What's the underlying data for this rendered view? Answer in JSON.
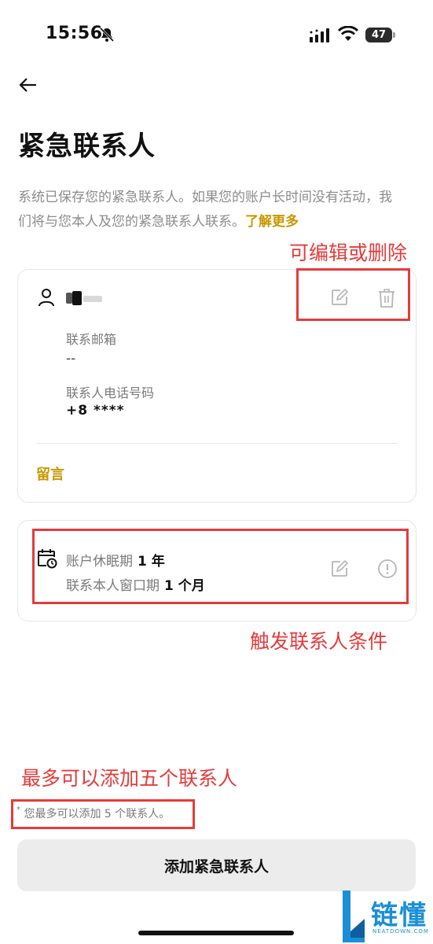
{
  "status_bar": {
    "time": "15:56",
    "battery_level": "47",
    "icons": [
      "bell-muted-icon",
      "signal-icon",
      "wifi-icon",
      "battery-icon"
    ]
  },
  "header": {
    "title": "紧急联系人"
  },
  "description": {
    "text": "系统已保存您的紧急联系人。如果您的账户长时间没有活动，我们将与您本人及您的紧急联系人联系。",
    "link": "了解更多"
  },
  "annotations": {
    "edit_delete": "可编辑或删除",
    "trigger": "触发联系人条件",
    "max": "最多可以添加五个联系人"
  },
  "contact_card": {
    "email_label": "联系邮箱",
    "email_value": "--",
    "phone_label": "联系人电话号码",
    "phone_value": "+8 ****",
    "message_link": "留言"
  },
  "conditions_card": {
    "dormancy_label": "账户休眠期",
    "dormancy_value": "1 年",
    "window_label": "联系本人窗口期",
    "window_value": "1 个月"
  },
  "footnote": {
    "star": "*",
    "text": "您最多可以添加 5 个联系人。"
  },
  "add_button": {
    "label": "添加紧急联系人"
  },
  "watermark": {
    "text": "链懂",
    "sub": "NEATDOWN.COM"
  },
  "colors": {
    "accent": "#c99700",
    "annotation_red": "#e53b3b",
    "button_bg": "#ececec",
    "muted_text": "#8c8c8c"
  }
}
